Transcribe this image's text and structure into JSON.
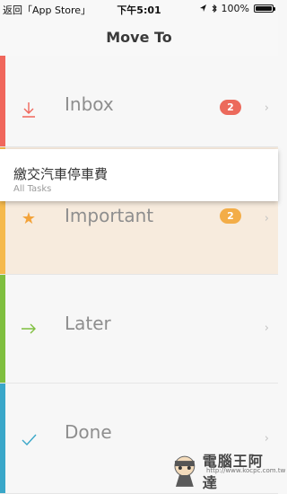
{
  "status_bar": {
    "back_label": "返回「App Store」",
    "time": "下午5:01",
    "battery": "100%",
    "icons": [
      "location-arrow-icon",
      "bluetooth-icon",
      "battery-icon"
    ]
  },
  "nav": {
    "title": "Move To"
  },
  "rows": [
    {
      "label": "Inbox",
      "badge": "2",
      "icon": "download-arrow-icon",
      "color": "#f0675c"
    },
    {
      "label": "Important",
      "badge": "2",
      "icon": "star-icon",
      "color": "#f3a33a"
    },
    {
      "label": "Later",
      "icon": "right-arrow-icon",
      "color": "#7fbf3f"
    },
    {
      "label": "Done",
      "icon": "checkmark-icon",
      "color": "#3aa7c9"
    }
  ],
  "drag_card": {
    "title": "繳交汽車停車費",
    "subtitle": "All Tasks"
  },
  "watermark": {
    "text": "電腦王阿達",
    "url": "http://www.kocpc.com.tw"
  }
}
